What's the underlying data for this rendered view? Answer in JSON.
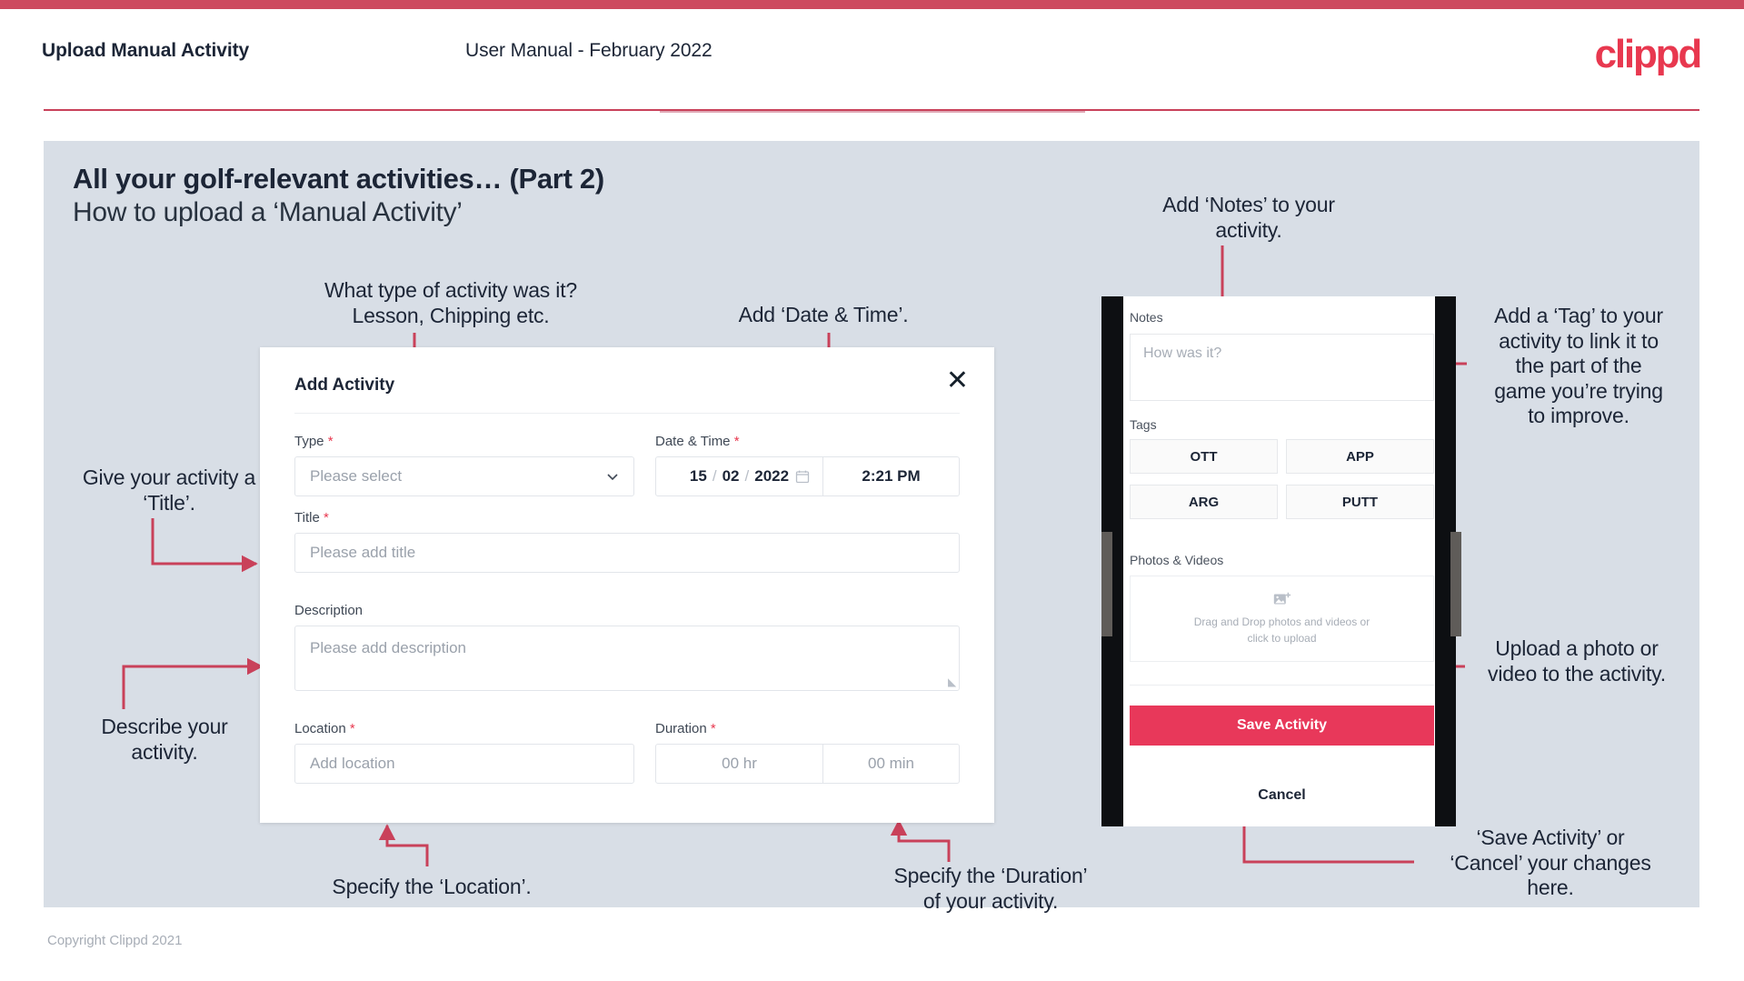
{
  "header": {
    "title": "Upload Manual Activity",
    "subtitle": "User Manual - February 2022",
    "logo": "clippd"
  },
  "slide": {
    "title": "All your golf-relevant activities… (Part 2)",
    "subtitle": "How to upload a ‘Manual Activity’"
  },
  "annotations": {
    "type": "What type of activity was it?\nLesson, Chipping etc.",
    "date_time": "Add ‘Date & Time’.",
    "title": "Give your activity a\n‘Title’.",
    "describe": "Describe your\nactivity.",
    "location": "Specify the ‘Location’.",
    "duration": "Specify the ‘Duration’\nof your activity.",
    "notes": "Add ‘Notes’ to your\nactivity.",
    "tag": "Add a ‘Tag’ to your\nactivity to link it to\nthe part of the\ngame you’re trying\nto improve.",
    "upload": "Upload a photo or\nvideo to the activity.",
    "save_cancel": "‘Save Activity’ or\n‘Cancel’ your changes\nhere."
  },
  "dialog": {
    "title": "Add Activity",
    "close": "✕",
    "fields": {
      "type": {
        "label": "Type",
        "required": "*",
        "placeholder": "Please select"
      },
      "date_time": {
        "label": "Date & Time",
        "required": "*",
        "day": "15",
        "month": "02",
        "year": "2022",
        "time": "2:21 PM"
      },
      "title": {
        "label": "Title",
        "required": "*",
        "placeholder": "Please add title"
      },
      "description": {
        "label": "Description",
        "required": "",
        "placeholder": "Please add description"
      },
      "location": {
        "label": "Location",
        "required": "*",
        "placeholder": "Add location"
      },
      "duration": {
        "label": "Duration",
        "required": "*",
        "hours": "00 hr",
        "minutes": "00 min"
      }
    }
  },
  "phone": {
    "notes_label": "Notes",
    "notes_placeholder": "How was it?",
    "tags_label": "Tags",
    "tags": [
      "OTT",
      "APP",
      "ARG",
      "PUTT"
    ],
    "photos_label": "Photos & Videos",
    "dropzone_line1": "Drag and Drop photos and videos or",
    "dropzone_line2": "click to upload",
    "save_label": "Save Activity",
    "cancel_label": "Cancel"
  },
  "footer": {
    "copyright": "Copyright Clippd 2021"
  },
  "colors": {
    "brand": "#e8384f",
    "accent_bar": "#cd4a5f",
    "slide_bg": "#d8dee6",
    "arrow": "#c9415a",
    "save_button": "#e8385a",
    "text": "#1c2536"
  }
}
